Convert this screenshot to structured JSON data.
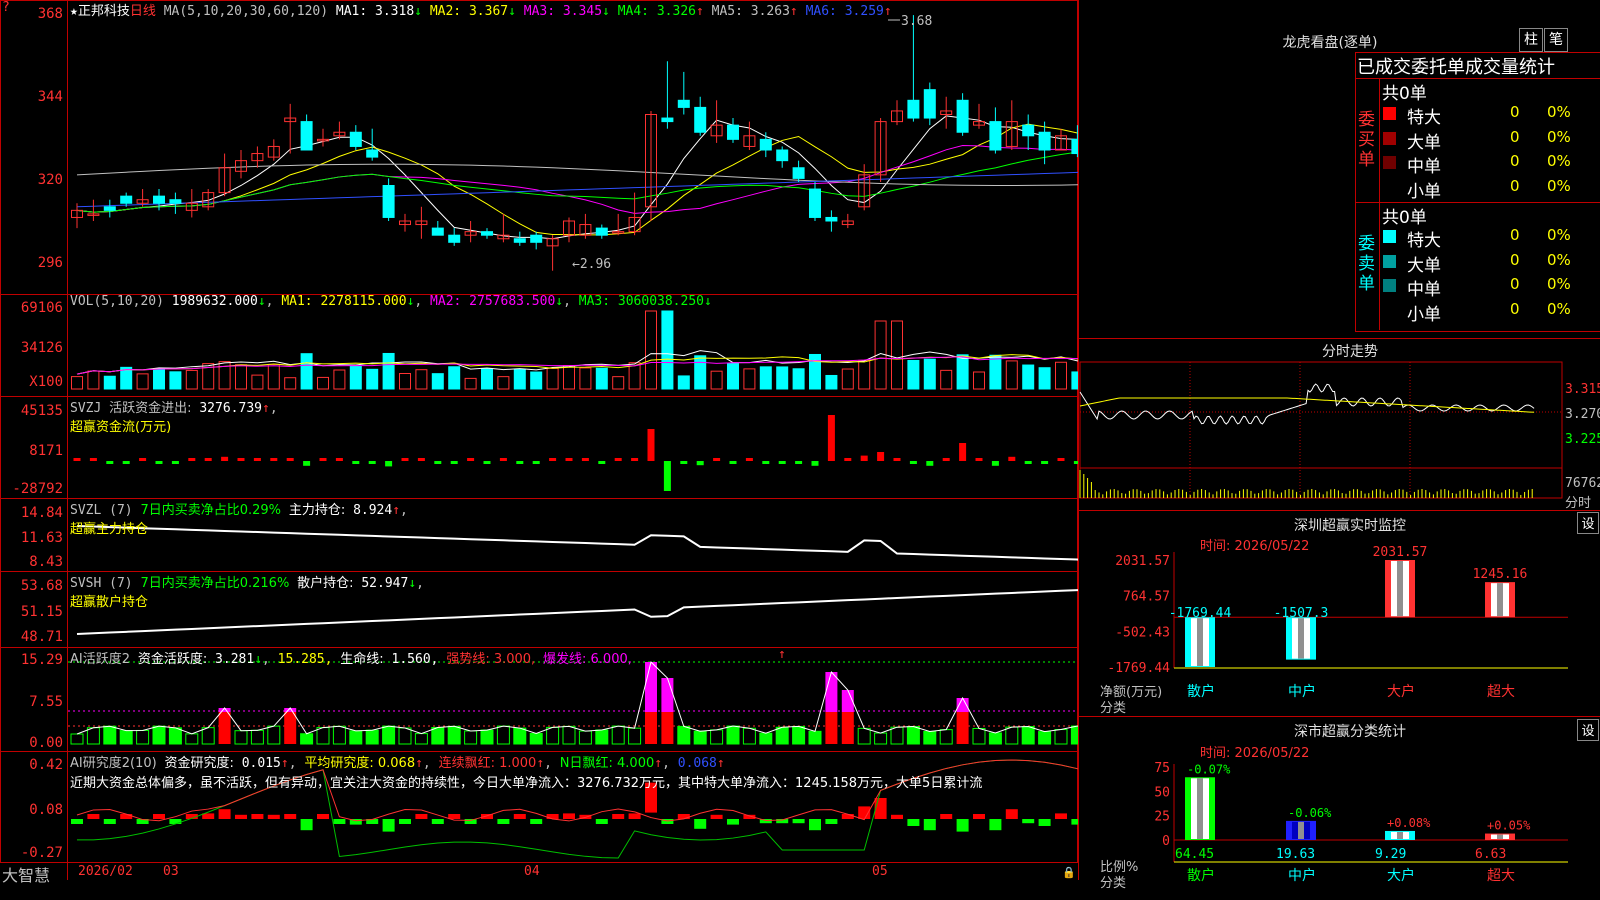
{
  "title": {
    "star": "★",
    "stock": "正邦科技",
    "period": "日线",
    "ma_def": "MA(5,10,20,30,60,120)",
    "ma": [
      {
        "label": "MA1:",
        "val": "3.318",
        "arrow": "↓",
        "color": "#ffffff"
      },
      {
        "label": "MA2:",
        "val": "3.367",
        "arrow": "↓",
        "color": "#ffff00"
      },
      {
        "label": "MA3:",
        "val": "3.345",
        "arrow": "↓",
        "color": "#ff00ff"
      },
      {
        "label": "MA4:",
        "val": "3.326",
        "arrow": "↑",
        "color": "#00ff00"
      },
      {
        "label": "MA5:",
        "val": "3.263",
        "arrow": "↑",
        "color": "#c0c0c0"
      },
      {
        "label": "MA6:",
        "val": "3.259",
        "arrow": "↑",
        "color": "#3050ff"
      }
    ]
  },
  "price_axis": [
    "368",
    "344",
    "320",
    "296"
  ],
  "price_annotations": {
    "high": "3.68",
    "low": "2.96"
  },
  "vol": {
    "hdr": "VOL(5,10,20)",
    "val": "1989632.000",
    "ma1": "MA1: 2278115.000",
    "ma2": "MA2: 2757683.500",
    "ma3": "MA3: 3060038.250",
    "axis": [
      "69106",
      "34126",
      "X100"
    ]
  },
  "svzj": {
    "hdr": "SVZJ",
    "l1": "活跃资金进出:",
    "v1": "3276.739",
    "l2": "超赢资金流(万元)",
    "axis": [
      "45135",
      "8171",
      "-28792"
    ]
  },
  "svzl": {
    "hdr": "SVZL (7)",
    "l1": "7日内买卖净占比0.29%",
    "l2": "主力持仓:",
    "v2": "8.924",
    "l3": "超赢主力持仓",
    "axis": [
      "14.84",
      "11.63",
      "8.43"
    ]
  },
  "svsh": {
    "hdr": "SVSH (7)",
    "l1": "7日内买卖净占比0.216%",
    "l2": "散户持仓:",
    "v2": "52.947",
    "l3": "超赢散户持仓",
    "axis": [
      "53.68",
      "51.15",
      "48.71"
    ]
  },
  "ai1": {
    "hdr": "AI活跃度2",
    "l1": "资金活跃度:",
    "v1": "3.281",
    "v2": "15.285,",
    "l3": "生命线:",
    "v3": "1.560,",
    "l4": "强势线: 3.000,",
    "l5": "爆发线: 6.000,",
    "axis": [
      "15.29",
      "7.55",
      "0.00"
    ]
  },
  "ai2": {
    "hdr": "AI研究度2(10)",
    "l1": "资金研究度:",
    "v1": "0.015",
    "l2": "平均研究度: 0.068",
    "l3": "连续飘红: 1.000",
    "l4": "N日飘红: 4.000",
    "v5": "0.068",
    "msg": "近期大资金总体偏多，虽不活跃，但有异动，宜关注大资金的持续性，今日大单净流入：3276.732万元，其中特大单净流入：1245.158万元，大单5日累计流",
    "axis": [
      "0.42",
      "0.08",
      "-0.27"
    ]
  },
  "bottom": {
    "brand": "大智慧",
    "dates": [
      "2026/02",
      "03",
      "04",
      "05"
    ]
  },
  "dragon": {
    "title": "龙虎看盘(逐单)",
    "btn1": "柱",
    "btn2": "笔",
    "header": "已成交委托单成交量统计",
    "buy_total": "共0单",
    "buy_label": "委买单",
    "sell_total": "共0单",
    "sell_label": "委卖单",
    "buy_rows": [
      {
        "name": "特大",
        "n": "0",
        "p": "0%",
        "c": "#ff0000"
      },
      {
        "name": "大单",
        "n": "0",
        "p": "0%",
        "c": "#a00000"
      },
      {
        "name": "中单",
        "n": "0",
        "p": "0%",
        "c": "#700000"
      },
      {
        "name": "小单",
        "n": "0",
        "p": "0%",
        "c": ""
      }
    ],
    "sell_rows": [
      {
        "name": "特大",
        "n": "0",
        "p": "0%",
        "c": "#00ffff"
      },
      {
        "name": "大单",
        "n": "0",
        "p": "0%",
        "c": "#00a0a0"
      },
      {
        "name": "中单",
        "n": "0",
        "p": "0%",
        "c": "#008080"
      },
      {
        "name": "小单",
        "n": "0",
        "p": "0%",
        "c": ""
      }
    ]
  },
  "intraday": {
    "title": "分时走势",
    "axis": [
      "3.315",
      "3.270",
      "3.225"
    ],
    "vol": "76762",
    "vol_lbl": "分时"
  },
  "sz_monitor": {
    "title": "深圳超赢实时监控",
    "btn": "设",
    "time": "时间: 2026/05/22",
    "ylabels": [
      "2031.57",
      "764.57",
      "-502.43",
      "-1769.44"
    ],
    "ylbl1": "净额(万元)",
    "ylbl2": "分类",
    "cats": [
      "散户",
      "中户",
      "大户",
      "超大"
    ],
    "values": [
      -1769.44,
      -1507.3,
      2031.57,
      1245.16
    ],
    "vlabels": [
      "-1769.44",
      "-1507.3",
      "2031.57",
      "1245.16"
    ]
  },
  "sz_class": {
    "title": "深市超赢分类统计",
    "btn": "设",
    "time": "时间: 2026/05/22",
    "ylabels": [
      "75",
      "50",
      "25",
      "0"
    ],
    "ylbl1": "比例%",
    "ylbl2": "分类",
    "cats": [
      "散户",
      "中户",
      "大户",
      "超大"
    ],
    "values": [
      64.45,
      19.63,
      9.29,
      6.63
    ],
    "vlabels": [
      "64.45",
      "19.63",
      "9.29",
      "6.63"
    ],
    "chg": [
      "-0.07%",
      "-0.06%",
      "+0.08%",
      "+0.05%"
    ]
  },
  "chart_data": {
    "type": "candlestick",
    "title": "正邦科技 日线",
    "ylim": [
      2.9,
      3.7
    ],
    "annotations": {
      "high": 3.68,
      "low": 2.96
    },
    "candles": [
      [
        3.11,
        3.13,
        3.08,
        3.15
      ],
      [
        3.12,
        3.12,
        3.1,
        3.16
      ],
      [
        3.14,
        3.13,
        3.11,
        3.16
      ],
      [
        3.17,
        3.15,
        3.14,
        3.18
      ],
      [
        3.15,
        3.16,
        3.14,
        3.19
      ],
      [
        3.17,
        3.15,
        3.13,
        3.19
      ],
      [
        3.16,
        3.15,
        3.12,
        3.18
      ],
      [
        3.13,
        3.15,
        3.11,
        3.19
      ],
      [
        3.14,
        3.18,
        3.13,
        3.19
      ],
      [
        3.18,
        3.25,
        3.17,
        3.29
      ],
      [
        3.24,
        3.27,
        3.22,
        3.3
      ],
      [
        3.27,
        3.29,
        3.25,
        3.31
      ],
      [
        3.28,
        3.31,
        3.27,
        3.33
      ],
      [
        3.38,
        3.39,
        3.29,
        3.43
      ],
      [
        3.38,
        3.3,
        3.3,
        3.4
      ],
      [
        3.33,
        3.33,
        3.31,
        3.36
      ],
      [
        3.34,
        3.35,
        3.33,
        3.38
      ],
      [
        3.35,
        3.31,
        3.3,
        3.37
      ],
      [
        3.3,
        3.28,
        3.27,
        3.36
      ],
      [
        3.2,
        3.11,
        3.1,
        3.22
      ],
      [
        3.09,
        3.1,
        3.07,
        3.12
      ],
      [
        3.09,
        3.1,
        3.05,
        3.14
      ],
      [
        3.08,
        3.06,
        3.06,
        3.1
      ],
      [
        3.06,
        3.04,
        3.03,
        3.08
      ],
      [
        3.06,
        3.07,
        3.04,
        3.1
      ],
      [
        3.07,
        3.06,
        3.05,
        3.08
      ],
      [
        3.05,
        3.06,
        3.04,
        3.12
      ],
      [
        3.05,
        3.04,
        3.03,
        3.07
      ],
      [
        3.06,
        3.04,
        3.02,
        3.07
      ],
      [
        3.03,
        3.05,
        2.96,
        3.06
      ],
      [
        3.06,
        3.1,
        3.04,
        3.11
      ],
      [
        3.06,
        3.09,
        3.05,
        3.12
      ],
      [
        3.08,
        3.06,
        3.05,
        3.09
      ],
      [
        3.07,
        3.07,
        3.06,
        3.12
      ],
      [
        3.07,
        3.11,
        3.06,
        3.18
      ],
      [
        3.14,
        3.4,
        3.1,
        3.41
      ],
      [
        3.39,
        3.38,
        3.36,
        3.55
      ],
      [
        3.44,
        3.42,
        3.4,
        3.52
      ],
      [
        3.42,
        3.35,
        3.34,
        3.45
      ],
      [
        3.34,
        3.37,
        3.32,
        3.44
      ],
      [
        3.37,
        3.33,
        3.32,
        3.39
      ],
      [
        3.31,
        3.34,
        3.3,
        3.38
      ],
      [
        3.33,
        3.3,
        3.28,
        3.35
      ],
      [
        3.3,
        3.27,
        3.25,
        3.31
      ],
      [
        3.25,
        3.22,
        3.21,
        3.27
      ],
      [
        3.19,
        3.11,
        3.1,
        3.21
      ],
      [
        3.11,
        3.1,
        3.07,
        3.13
      ],
      [
        3.09,
        3.1,
        3.08,
        3.12
      ],
      [
        3.14,
        3.23,
        3.13,
        3.26
      ],
      [
        3.23,
        3.38,
        3.21,
        3.39
      ],
      [
        3.38,
        3.41,
        3.37,
        3.44
      ],
      [
        3.44,
        3.39,
        3.38,
        3.68
      ],
      [
        3.47,
        3.39,
        3.37,
        3.49
      ],
      [
        3.4,
        3.41,
        3.36,
        3.45
      ],
      [
        3.44,
        3.35,
        3.34,
        3.46
      ],
      [
        3.37,
        3.38,
        3.36,
        3.43
      ],
      [
        3.38,
        3.3,
        3.29,
        3.42
      ],
      [
        3.31,
        3.38,
        3.3,
        3.44
      ],
      [
        3.37,
        3.34,
        3.3,
        3.4
      ],
      [
        3.35,
        3.3,
        3.26,
        3.38
      ],
      [
        3.3,
        3.34,
        3.3,
        3.36
      ],
      [
        3.33,
        3.29,
        3.28,
        3.37
      ],
      [
        3.31,
        3.28,
        3.27,
        3.33
      ]
    ]
  }
}
